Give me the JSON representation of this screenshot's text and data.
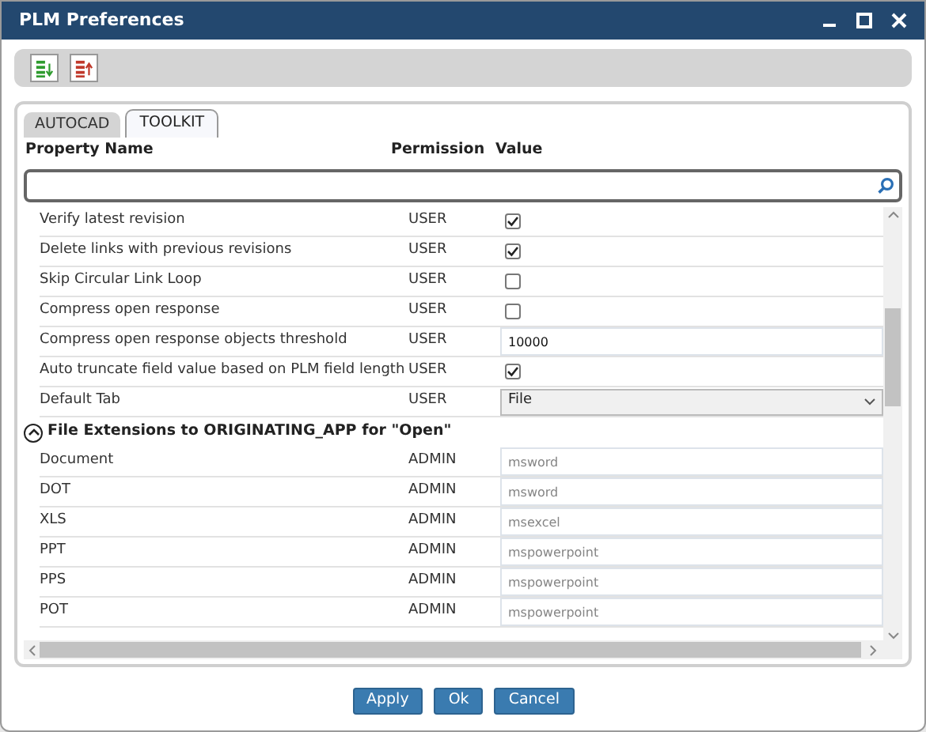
{
  "window": {
    "title": "PLM Preferences"
  },
  "toolbar": [
    {
      "kind": "import"
    },
    {
      "kind": "export"
    }
  ],
  "tabs": [
    {
      "label": "AUTOCAD",
      "selected": false
    },
    {
      "label": "TOOLKIT",
      "selected": true
    }
  ],
  "columns": [
    "Property Name",
    "Permission",
    "Value"
  ],
  "search": {
    "focused": true
  },
  "rows": [
    {
      "name": "Verify latest revision",
      "permission": "USER",
      "kind": "checkbox",
      "checked": true
    },
    {
      "name": "Delete links with previous revisions",
      "permission": "USER",
      "kind": "checkbox",
      "checked": true
    },
    {
      "name": "Skip Circular Link Loop",
      "permission": "USER",
      "kind": "checkbox",
      "checked": false
    },
    {
      "name": "Compress open response",
      "permission": "USER",
      "kind": "checkbox",
      "checked": false
    },
    {
      "name": "Compress open response objects threshold",
      "permission": "USER",
      "kind": "text",
      "value": "10000",
      "disabled": false
    },
    {
      "name": "Auto truncate field value based on PLM field length",
      "permission": "USER",
      "kind": "checkbox",
      "checked": true
    },
    {
      "name": "Default Tab",
      "permission": "USER",
      "kind": "select",
      "value": "File"
    }
  ],
  "section": {
    "title": "File Extensions to ORIGINATING_APP for \"Open\"",
    "expanded": true,
    "rows": [
      {
        "name": "Document",
        "permission": "ADMIN",
        "kind": "text",
        "value": "msword",
        "disabled": true
      },
      {
        "name": "DOT",
        "permission": "ADMIN",
        "kind": "text",
        "value": "msword",
        "disabled": true
      },
      {
        "name": "XLS",
        "permission": "ADMIN",
        "kind": "text",
        "value": "msexcel",
        "disabled": true
      },
      {
        "name": "PPT",
        "permission": "ADMIN",
        "kind": "text",
        "value": "mspowerpoint",
        "disabled": true
      },
      {
        "name": "PPS",
        "permission": "ADMIN",
        "kind": "text",
        "value": "mspowerpoint",
        "disabled": true
      },
      {
        "name": "POT",
        "permission": "ADMIN",
        "kind": "text",
        "value": "mspowerpoint",
        "disabled": true
      }
    ]
  },
  "buttons": [
    "Apply",
    "Ok",
    "Cancel"
  ]
}
